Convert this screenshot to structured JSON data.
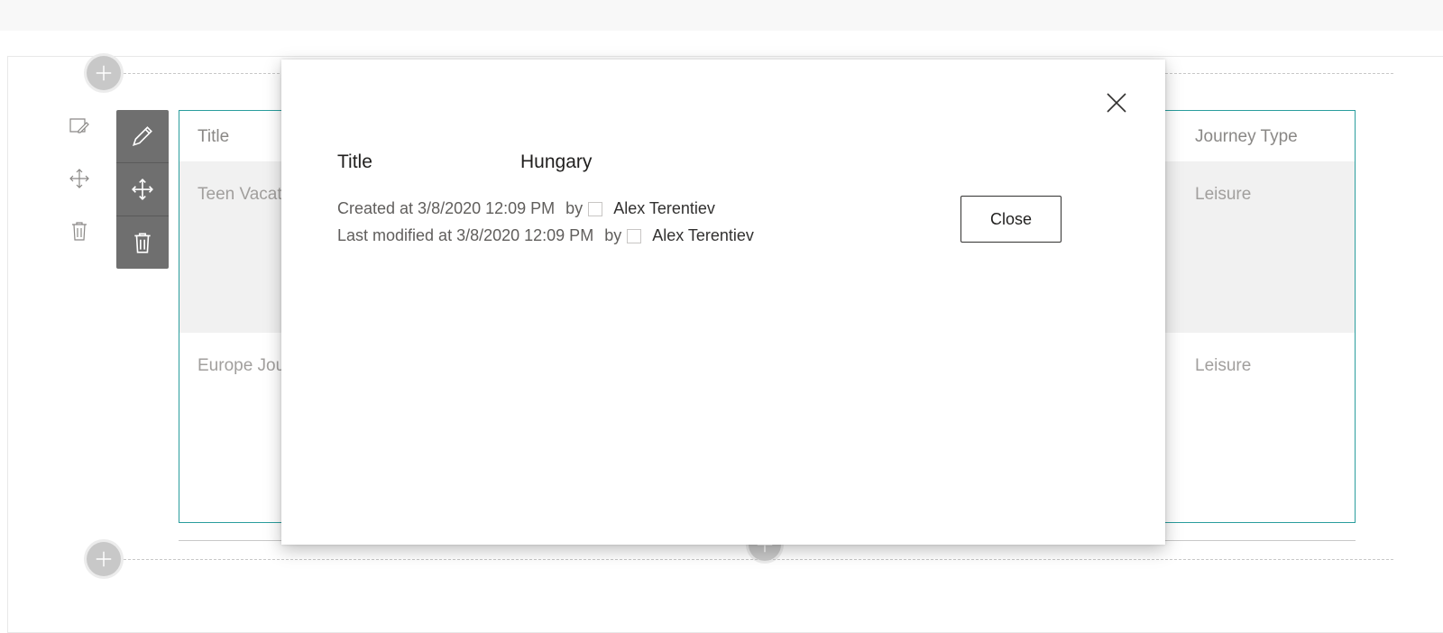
{
  "list": {
    "columns": {
      "title": "Title",
      "journey_type": "Journey Type"
    },
    "rows": [
      {
        "title": "Teen Vacat",
        "journey_type": "Leisure"
      },
      {
        "title": "Europe Jou",
        "journey_type": "Leisure"
      }
    ]
  },
  "dialog": {
    "field_label": "Title",
    "field_value": "Hungary",
    "created_text": "Created at 3/8/2020 12:09 PM",
    "modified_text": "Last modified at 3/8/2020 12:09 PM",
    "by_label": "by",
    "created_by": "Alex Terentiev",
    "modified_by": "Alex Terentiev",
    "close_button_label": "Close"
  },
  "icons": {
    "add": "plus-icon",
    "edit_section": "edit-section-icon",
    "move_section": "move-icon",
    "delete_section": "trash-icon",
    "edit_webpart": "pencil-icon",
    "move_webpart": "move-icon",
    "delete_webpart": "trash-icon",
    "dialog_close": "close-icon"
  },
  "colors": {
    "webpart_border": "#2a9d9d",
    "toolbar_bg": "#6f6f6f",
    "selected_row_bg": "#f1f1f1"
  }
}
